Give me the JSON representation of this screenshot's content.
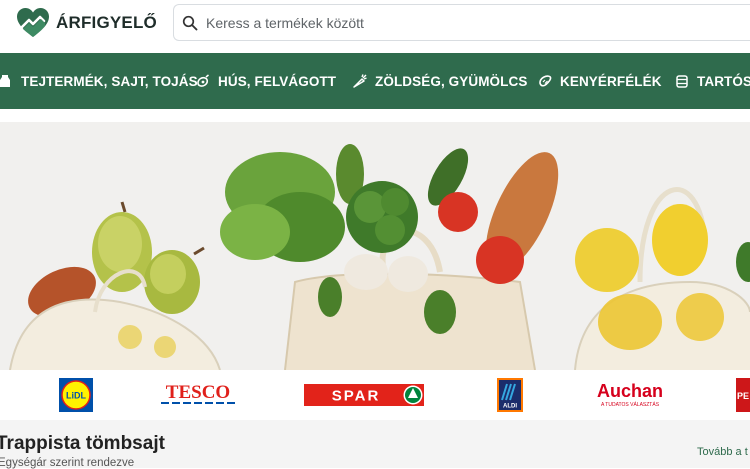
{
  "header": {
    "logo_text": "ÁRFIGYELŐ",
    "search_placeholder": "Keress a termékek között"
  },
  "nav": {
    "items": [
      {
        "label": "TEJTERMÉK, SAJT, TOJÁS",
        "icon": "milk-icon"
      },
      {
        "label": "HÚS, FELVÁGOTT",
        "icon": "meat-icon"
      },
      {
        "label": "ZÖLDSÉG, GYÜMÖLCS",
        "icon": "carrot-icon"
      },
      {
        "label": "KENYÉRFÉLÉK",
        "icon": "bread-icon"
      },
      {
        "label": "TARTÓS",
        "icon": "can-icon"
      }
    ]
  },
  "stores": [
    {
      "name": "Lidl",
      "text": "LiDL"
    },
    {
      "name": "Tesco",
      "text": "TESCO"
    },
    {
      "name": "Spar",
      "text": "SPAR"
    },
    {
      "name": "Aldi",
      "text": "ALDI"
    },
    {
      "name": "Auchan",
      "text": "Auchan",
      "tagline": "A TUDATOS VÁLASZTÁS"
    },
    {
      "name": "Penny",
      "text": "PE"
    }
  ],
  "section": {
    "title": "Trappista tömbsajt",
    "subtitle": "Egységár szerint rendezve",
    "more_link": "Tovább a t"
  },
  "colors": {
    "brand_green": "#2f6b4d",
    "lidl_blue": "#0050aa",
    "tesco_red": "#e0201b",
    "spar_red": "#e2231a",
    "aldi_blue": "#1b2d6b",
    "auchan_red": "#d6001c"
  }
}
